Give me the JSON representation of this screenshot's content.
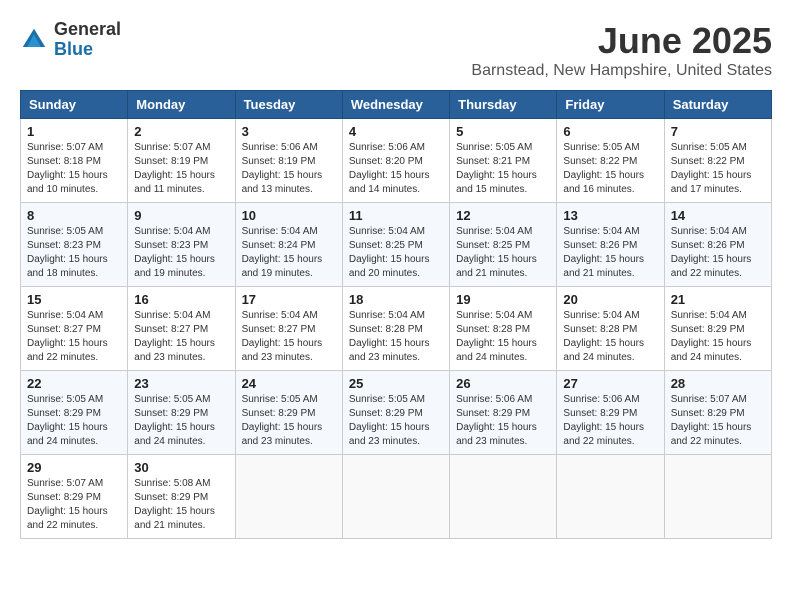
{
  "logo": {
    "general": "General",
    "blue": "Blue"
  },
  "title": "June 2025",
  "location": "Barnstead, New Hampshire, United States",
  "headers": [
    "Sunday",
    "Monday",
    "Tuesday",
    "Wednesday",
    "Thursday",
    "Friday",
    "Saturday"
  ],
  "weeks": [
    [
      {
        "day": "1",
        "sunrise": "Sunrise: 5:07 AM",
        "sunset": "Sunset: 8:18 PM",
        "daylight": "Daylight: 15 hours and 10 minutes."
      },
      {
        "day": "2",
        "sunrise": "Sunrise: 5:07 AM",
        "sunset": "Sunset: 8:19 PM",
        "daylight": "Daylight: 15 hours and 11 minutes."
      },
      {
        "day": "3",
        "sunrise": "Sunrise: 5:06 AM",
        "sunset": "Sunset: 8:19 PM",
        "daylight": "Daylight: 15 hours and 13 minutes."
      },
      {
        "day": "4",
        "sunrise": "Sunrise: 5:06 AM",
        "sunset": "Sunset: 8:20 PM",
        "daylight": "Daylight: 15 hours and 14 minutes."
      },
      {
        "day": "5",
        "sunrise": "Sunrise: 5:05 AM",
        "sunset": "Sunset: 8:21 PM",
        "daylight": "Daylight: 15 hours and 15 minutes."
      },
      {
        "day": "6",
        "sunrise": "Sunrise: 5:05 AM",
        "sunset": "Sunset: 8:22 PM",
        "daylight": "Daylight: 15 hours and 16 minutes."
      },
      {
        "day": "7",
        "sunrise": "Sunrise: 5:05 AM",
        "sunset": "Sunset: 8:22 PM",
        "daylight": "Daylight: 15 hours and 17 minutes."
      }
    ],
    [
      {
        "day": "8",
        "sunrise": "Sunrise: 5:05 AM",
        "sunset": "Sunset: 8:23 PM",
        "daylight": "Daylight: 15 hours and 18 minutes."
      },
      {
        "day": "9",
        "sunrise": "Sunrise: 5:04 AM",
        "sunset": "Sunset: 8:23 PM",
        "daylight": "Daylight: 15 hours and 19 minutes."
      },
      {
        "day": "10",
        "sunrise": "Sunrise: 5:04 AM",
        "sunset": "Sunset: 8:24 PM",
        "daylight": "Daylight: 15 hours and 19 minutes."
      },
      {
        "day": "11",
        "sunrise": "Sunrise: 5:04 AM",
        "sunset": "Sunset: 8:25 PM",
        "daylight": "Daylight: 15 hours and 20 minutes."
      },
      {
        "day": "12",
        "sunrise": "Sunrise: 5:04 AM",
        "sunset": "Sunset: 8:25 PM",
        "daylight": "Daylight: 15 hours and 21 minutes."
      },
      {
        "day": "13",
        "sunrise": "Sunrise: 5:04 AM",
        "sunset": "Sunset: 8:26 PM",
        "daylight": "Daylight: 15 hours and 21 minutes."
      },
      {
        "day": "14",
        "sunrise": "Sunrise: 5:04 AM",
        "sunset": "Sunset: 8:26 PM",
        "daylight": "Daylight: 15 hours and 22 minutes."
      }
    ],
    [
      {
        "day": "15",
        "sunrise": "Sunrise: 5:04 AM",
        "sunset": "Sunset: 8:27 PM",
        "daylight": "Daylight: 15 hours and 22 minutes."
      },
      {
        "day": "16",
        "sunrise": "Sunrise: 5:04 AM",
        "sunset": "Sunset: 8:27 PM",
        "daylight": "Daylight: 15 hours and 23 minutes."
      },
      {
        "day": "17",
        "sunrise": "Sunrise: 5:04 AM",
        "sunset": "Sunset: 8:27 PM",
        "daylight": "Daylight: 15 hours and 23 minutes."
      },
      {
        "day": "18",
        "sunrise": "Sunrise: 5:04 AM",
        "sunset": "Sunset: 8:28 PM",
        "daylight": "Daylight: 15 hours and 23 minutes."
      },
      {
        "day": "19",
        "sunrise": "Sunrise: 5:04 AM",
        "sunset": "Sunset: 8:28 PM",
        "daylight": "Daylight: 15 hours and 24 minutes."
      },
      {
        "day": "20",
        "sunrise": "Sunrise: 5:04 AM",
        "sunset": "Sunset: 8:28 PM",
        "daylight": "Daylight: 15 hours and 24 minutes."
      },
      {
        "day": "21",
        "sunrise": "Sunrise: 5:04 AM",
        "sunset": "Sunset: 8:29 PM",
        "daylight": "Daylight: 15 hours and 24 minutes."
      }
    ],
    [
      {
        "day": "22",
        "sunrise": "Sunrise: 5:05 AM",
        "sunset": "Sunset: 8:29 PM",
        "daylight": "Daylight: 15 hours and 24 minutes."
      },
      {
        "day": "23",
        "sunrise": "Sunrise: 5:05 AM",
        "sunset": "Sunset: 8:29 PM",
        "daylight": "Daylight: 15 hours and 24 minutes."
      },
      {
        "day": "24",
        "sunrise": "Sunrise: 5:05 AM",
        "sunset": "Sunset: 8:29 PM",
        "daylight": "Daylight: 15 hours and 23 minutes."
      },
      {
        "day": "25",
        "sunrise": "Sunrise: 5:05 AM",
        "sunset": "Sunset: 8:29 PM",
        "daylight": "Daylight: 15 hours and 23 minutes."
      },
      {
        "day": "26",
        "sunrise": "Sunrise: 5:06 AM",
        "sunset": "Sunset: 8:29 PM",
        "daylight": "Daylight: 15 hours and 23 minutes."
      },
      {
        "day": "27",
        "sunrise": "Sunrise: 5:06 AM",
        "sunset": "Sunset: 8:29 PM",
        "daylight": "Daylight: 15 hours and 22 minutes."
      },
      {
        "day": "28",
        "sunrise": "Sunrise: 5:07 AM",
        "sunset": "Sunset: 8:29 PM",
        "daylight": "Daylight: 15 hours and 22 minutes."
      }
    ],
    [
      {
        "day": "29",
        "sunrise": "Sunrise: 5:07 AM",
        "sunset": "Sunset: 8:29 PM",
        "daylight": "Daylight: 15 hours and 22 minutes."
      },
      {
        "day": "30",
        "sunrise": "Sunrise: 5:08 AM",
        "sunset": "Sunset: 8:29 PM",
        "daylight": "Daylight: 15 hours and 21 minutes."
      },
      null,
      null,
      null,
      null,
      null
    ]
  ]
}
